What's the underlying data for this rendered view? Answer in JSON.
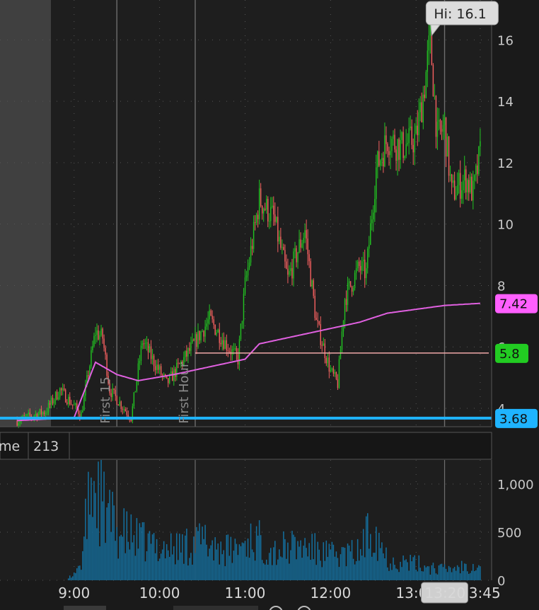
{
  "chart_data": [
    {
      "type": "candlestick",
      "y_ticks": [
        4,
        6,
        8,
        10,
        12,
        14,
        16
      ],
      "ylim": [
        3.4,
        17.3
      ],
      "x_ticks": [
        "9:00",
        "10:00",
        "11:00",
        "12:00",
        "13:00",
        "13:20",
        "13:45"
      ],
      "session_start_label": "9:00",
      "high_label": "Hi: 16.1",
      "high_value": 16.1,
      "vertical_markers": [
        "First 15",
        "First Hour"
      ],
      "price_levels": [
        {
          "label": "7.42",
          "value": 7.42,
          "color": "#ff5fff",
          "series": "vwap"
        },
        {
          "label": "5.8",
          "value": 5.8,
          "color": "#22cc22",
          "series": "last"
        },
        {
          "label": "3.68",
          "value": 3.68,
          "color": "#1fb4ff",
          "series": "support"
        }
      ],
      "price_anchors": [
        {
          "t": "8:20",
          "price": 3.6
        },
        {
          "t": "8:40",
          "price": 3.9
        },
        {
          "t": "8:50",
          "price": 4.6
        },
        {
          "t": "9:05",
          "price": 3.8
        },
        {
          "t": "9:15",
          "price": 6.5
        },
        {
          "t": "9:20",
          "price": 6.3
        },
        {
          "t": "9:25",
          "price": 4.6
        },
        {
          "t": "9:40",
          "price": 3.7
        },
        {
          "t": "9:48",
          "price": 6.2
        },
        {
          "t": "9:55",
          "price": 5.6
        },
        {
          "t": "10:05",
          "price": 4.8
        },
        {
          "t": "10:20",
          "price": 5.8
        },
        {
          "t": "10:35",
          "price": 6.9
        },
        {
          "t": "10:48",
          "price": 6.0
        },
        {
          "t": "10:55",
          "price": 5.6
        },
        {
          "t": "11:00",
          "price": 8.0
        },
        {
          "t": "11:10",
          "price": 10.8
        },
        {
          "t": "11:20",
          "price": 10.2
        },
        {
          "t": "11:30",
          "price": 8.2
        },
        {
          "t": "11:42",
          "price": 9.8
        },
        {
          "t": "11:50",
          "price": 6.8
        },
        {
          "t": "12:00",
          "price": 5.2
        },
        {
          "t": "12:05",
          "price": 4.8
        },
        {
          "t": "12:10",
          "price": 7.6
        },
        {
          "t": "12:20",
          "price": 8.6
        },
        {
          "t": "12:25",
          "price": 8.4
        },
        {
          "t": "12:32",
          "price": 11.8
        },
        {
          "t": "12:40",
          "price": 12.8
        },
        {
          "t": "12:50",
          "price": 12.5
        },
        {
          "t": "13:00",
          "price": 12.8
        },
        {
          "t": "13:05",
          "price": 14.2
        },
        {
          "t": "13:10",
          "price": 16.0
        },
        {
          "t": "13:15",
          "price": 12.8
        },
        {
          "t": "13:20",
          "price": 13.2
        },
        {
          "t": "13:25",
          "price": 11.0
        },
        {
          "t": "13:35",
          "price": 11.5
        },
        {
          "t": "13:40",
          "price": 11.0
        },
        {
          "t": "13:45",
          "price": 12.3
        }
      ],
      "vwap_anchors": [
        {
          "t": "8:20",
          "price": 3.6
        },
        {
          "t": "9:00",
          "price": 3.7
        },
        {
          "t": "9:15",
          "price": 5.5
        },
        {
          "t": "9:30",
          "price": 5.1
        },
        {
          "t": "9:45",
          "price": 4.9
        },
        {
          "t": "10:10",
          "price": 5.1
        },
        {
          "t": "10:40",
          "price": 5.4
        },
        {
          "t": "11:00",
          "price": 5.6
        },
        {
          "t": "11:10",
          "price": 6.1
        },
        {
          "t": "11:40",
          "price": 6.4
        },
        {
          "t": "12:00",
          "price": 6.6
        },
        {
          "t": "12:20",
          "price": 6.8
        },
        {
          "t": "12:40",
          "price": 7.1
        },
        {
          "t": "13:20",
          "price": 7.35
        },
        {
          "t": "13:45",
          "price": 7.42
        }
      ]
    },
    {
      "type": "bar",
      "title": "Volume",
      "visible_title": "me",
      "current_value": "213",
      "y_ticks": [
        0,
        500,
        1000
      ],
      "y_tick_labels": [
        "0",
        "500",
        "1,000"
      ],
      "ylim": [
        0,
        1250
      ],
      "volume_anchors": [
        {
          "t": "8:20",
          "v": 0
        },
        {
          "t": "8:55",
          "v": 0
        },
        {
          "t": "9:05",
          "v": 200
        },
        {
          "t": "9:12",
          "v": 1200
        },
        {
          "t": "9:20",
          "v": 900
        },
        {
          "t": "9:30",
          "v": 600
        },
        {
          "t": "9:50",
          "v": 450
        },
        {
          "t": "10:10",
          "v": 380
        },
        {
          "t": "10:30",
          "v": 480
        },
        {
          "t": "10:50",
          "v": 350
        },
        {
          "t": "11:05",
          "v": 520
        },
        {
          "t": "11:20",
          "v": 360
        },
        {
          "t": "11:40",
          "v": 420
        },
        {
          "t": "12:00",
          "v": 300
        },
        {
          "t": "12:20",
          "v": 330
        },
        {
          "t": "12:30",
          "v": 700
        },
        {
          "t": "12:40",
          "v": 250
        },
        {
          "t": "13:00",
          "v": 200
        },
        {
          "t": "13:20",
          "v": 130
        },
        {
          "t": "13:45",
          "v": 213
        }
      ]
    }
  ],
  "colors": {
    "background": "#1a1a1a",
    "price_panel": "#1e1e1e",
    "premarket_shade": "#404040",
    "up_candle": "#22c322",
    "down_candle": "#f25f5f",
    "vwap": "#e060e0",
    "last_price_line": "#f0a8a8",
    "support_line": "#1fb4ff",
    "volume_bar": "#146f9e",
    "grid_dot": "#555555"
  }
}
